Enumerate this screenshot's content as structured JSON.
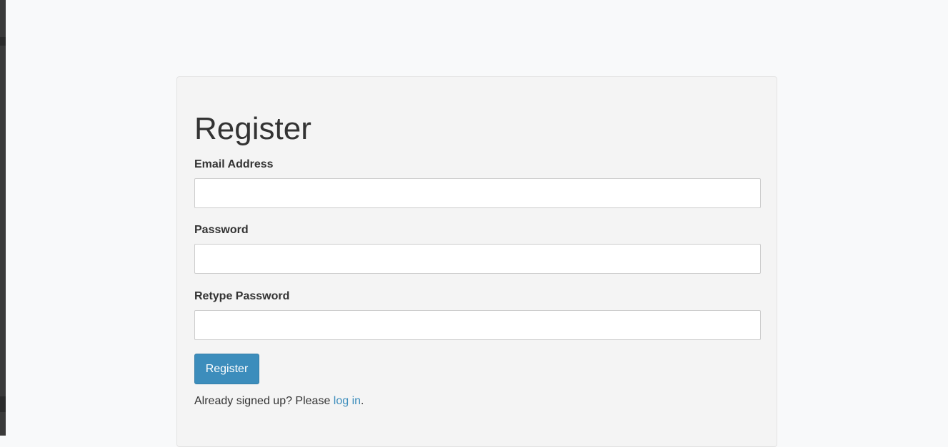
{
  "form": {
    "title": "Register",
    "fields": [
      {
        "label": "Email Address",
        "value": "",
        "placeholder": ""
      },
      {
        "label": "Password",
        "value": "",
        "placeholder": ""
      },
      {
        "label": "Retype Password",
        "value": "",
        "placeholder": ""
      }
    ],
    "submit_label": "Register",
    "footer": {
      "prefix": "Already signed up? Please ",
      "link_text": "log in",
      "suffix": "."
    }
  },
  "colors": {
    "page_background": "#f8f9fa",
    "card_background": "#f4f4f4",
    "primary_button": "#3c8dbc",
    "link": "#3c8dbc",
    "left_edge": "#3a3a3a"
  }
}
